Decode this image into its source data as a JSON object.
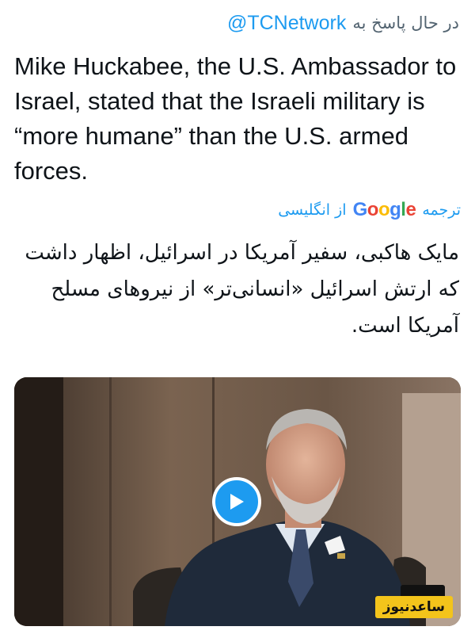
{
  "reply": {
    "prefix": "در حال پاسخ به",
    "handle": "@TCNetwork"
  },
  "tweet": {
    "text": "Mike Huckabee, the U.S. Ambassador to Israel, stated that the Israeli military is “more humane” than the U.S. armed forces."
  },
  "translation": {
    "prefix": "ترجمه",
    "provider": "Google",
    "suffix": "از انگلیسی",
    "text": "مایک هاکبی، سفیر آمریکا در اسرائیل، اظهار داشت که ارتش اسرائیل «انسانی‌تر» از نیروهای مسلح آمریکا است."
  },
  "media": {
    "type": "video",
    "play_icon": "play-icon",
    "accent_color": "#1d9bf0"
  },
  "watermark": {
    "text": "ساعدنیوز"
  }
}
